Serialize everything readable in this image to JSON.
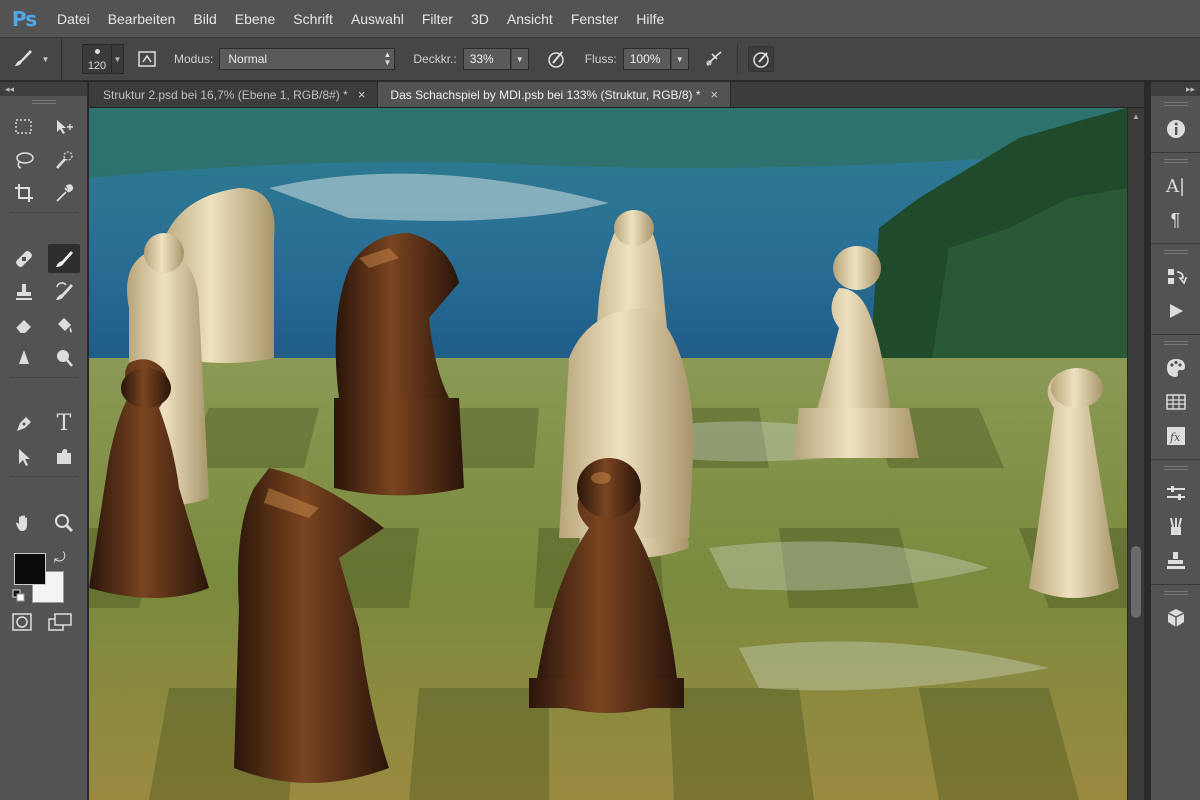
{
  "app": {
    "logo": "Ps"
  },
  "menu": [
    "Datei",
    "Bearbeiten",
    "Bild",
    "Ebene",
    "Schrift",
    "Auswahl",
    "Filter",
    "3D",
    "Ansicht",
    "Fenster",
    "Hilfe"
  ],
  "options": {
    "brush_size": "120",
    "mode_label": "Modus:",
    "mode_value": "Normal",
    "opacity_label": "Deckkr.:",
    "opacity_value": "33%",
    "flow_label": "Fluss:",
    "flow_value": "100%"
  },
  "tabs": [
    {
      "label": "Struktur 2.psd bei 16,7% (Ebene 1, RGB/8#) *",
      "close": "×"
    },
    {
      "label": "Das Schachspiel by MDI.psb bei 133% (Struktur, RGB/8) *",
      "close": "×"
    }
  ],
  "active_tab": 1,
  "collapse_left": "◂◂",
  "collapse_right": "▸▸",
  "colors": {
    "foreground": "#0b0b0b",
    "background": "#f4f4f4",
    "accent": "#4fa9e8"
  }
}
